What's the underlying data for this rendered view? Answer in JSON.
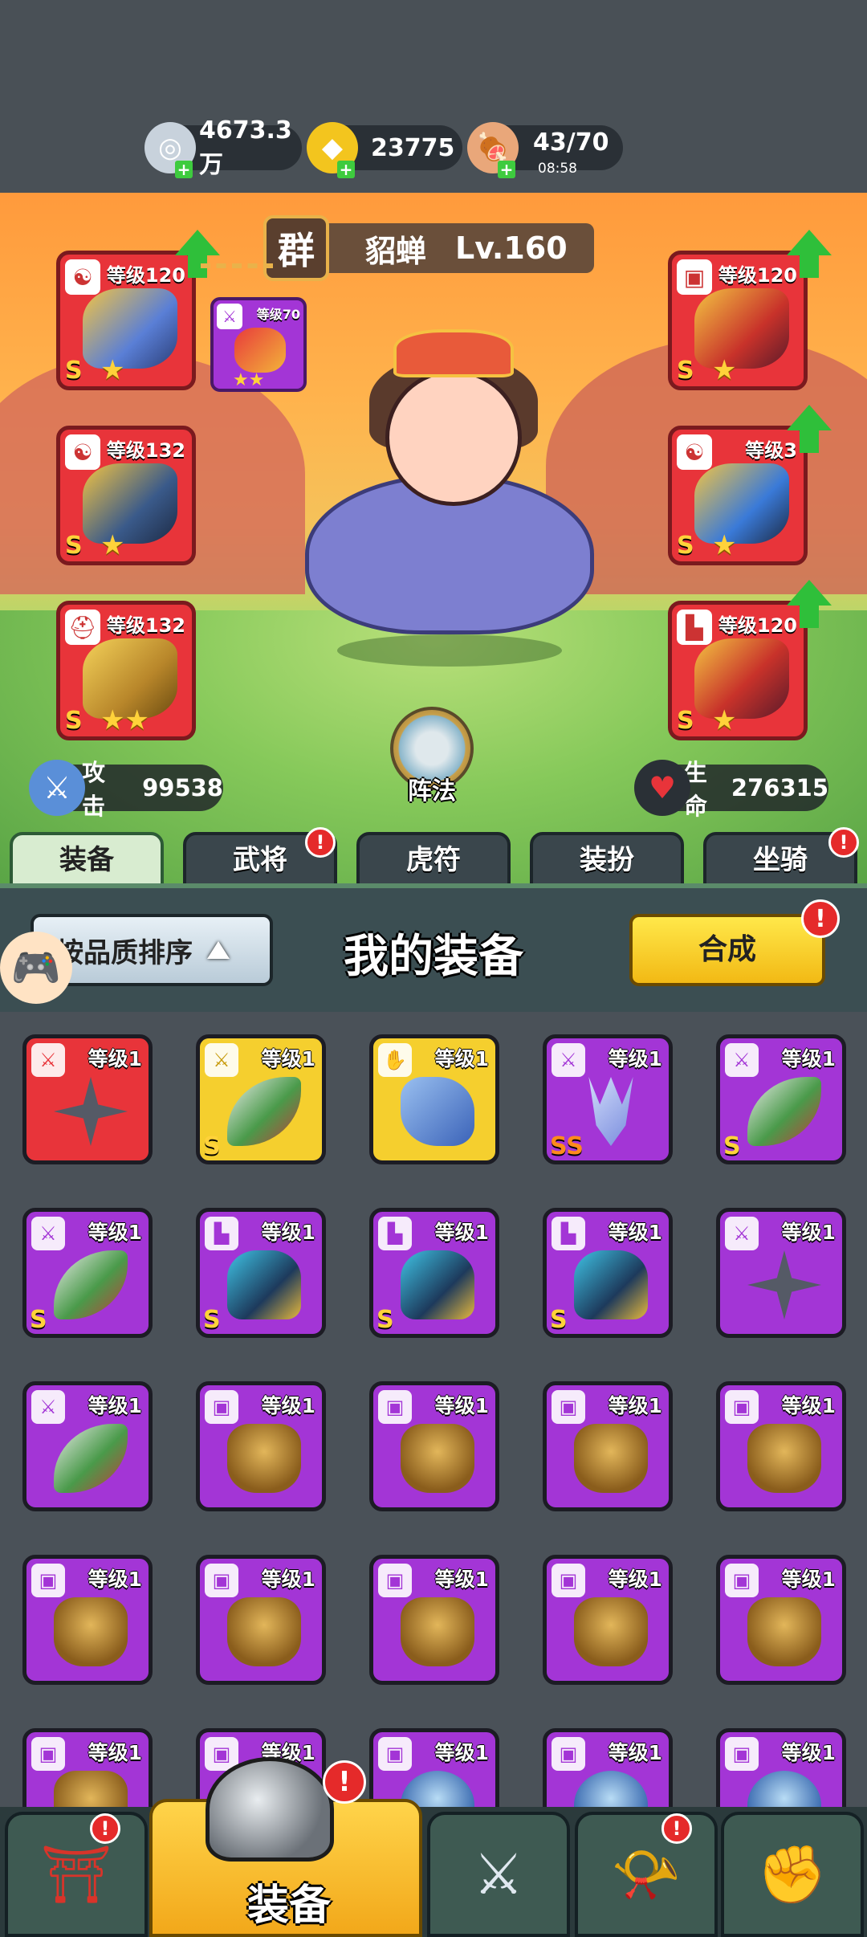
{
  "resources": [
    {
      "name": "silver",
      "icon": "silver-coin-icon",
      "value": "4673.3万"
    },
    {
      "name": "gold",
      "icon": "gold-ingot-icon",
      "value": "23775"
    },
    {
      "name": "stamina",
      "icon": "meat-icon",
      "value": "43/70",
      "timer": "08:58"
    }
  ],
  "hero": {
    "faction": "群",
    "name": "貂蝉",
    "level": "Lv.160"
  },
  "equipped": {
    "left": [
      {
        "slot": "weapon",
        "icon": "yinyang-icon",
        "level": "等级120",
        "rank": "S",
        "stars": "★"
      },
      {
        "slot": "accessory",
        "icon": "yinyang-icon",
        "level": "等级132",
        "rank": "S",
        "stars": "★"
      },
      {
        "slot": "helmet",
        "icon": "helmet-icon",
        "level": "等级132",
        "rank": "S",
        "stars": "★★"
      }
    ],
    "right": [
      {
        "slot": "armor",
        "icon": "armor-icon",
        "level": "等级120",
        "rank": "S",
        "stars": "★"
      },
      {
        "slot": "accessory",
        "icon": "yinyang-icon",
        "level": "等级3",
        "rank": "S",
        "stars": "★"
      },
      {
        "slot": "boots",
        "icon": "boot-icon",
        "level": "等级120",
        "rank": "S",
        "stars": "★"
      }
    ],
    "linked": {
      "level": "等级70",
      "stars": "★★"
    }
  },
  "formation_label": "阵法",
  "stats": {
    "attack_label": "攻击",
    "attack_value": "99538",
    "hp_label": "生命",
    "hp_value": "276315"
  },
  "tabs": [
    {
      "label": "装备",
      "active": true,
      "alert": false
    },
    {
      "label": "武将",
      "active": false,
      "alert": true
    },
    {
      "label": "虎符",
      "active": false,
      "alert": false
    },
    {
      "label": "装扮",
      "active": false,
      "alert": false
    },
    {
      "label": "坐骑",
      "active": false,
      "alert": true
    }
  ],
  "panel": {
    "sort_label": "按品质排序",
    "title": "我的装备",
    "combine_label": "合成",
    "alert": "!"
  },
  "inventory": [
    {
      "color": "red",
      "type": "weapon",
      "art": "shuriken",
      "level": "等级1",
      "rank": ""
    },
    {
      "color": "gold",
      "type": "weapon",
      "art": "blade",
      "level": "等级1",
      "rank": "S"
    },
    {
      "color": "gold",
      "type": "gauntlet",
      "art": "gauntlet",
      "level": "等级1",
      "rank": ""
    },
    {
      "color": "purple",
      "type": "weapon",
      "art": "trident",
      "level": "等级1",
      "rank": "SS"
    },
    {
      "color": "purple",
      "type": "weapon",
      "art": "blade",
      "level": "等级1",
      "rank": "S"
    },
    {
      "color": "purple",
      "type": "weapon",
      "art": "blade",
      "level": "等级1",
      "rank": "S"
    },
    {
      "color": "purple",
      "type": "boots",
      "art": "boots",
      "level": "等级1",
      "rank": "S"
    },
    {
      "color": "purple",
      "type": "boots",
      "art": "boots",
      "level": "等级1",
      "rank": "S"
    },
    {
      "color": "purple",
      "type": "boots",
      "art": "boots",
      "level": "等级1",
      "rank": "S"
    },
    {
      "color": "purple",
      "type": "weapon",
      "art": "shuriken",
      "level": "等级1",
      "rank": ""
    },
    {
      "color": "purple",
      "type": "weapon",
      "art": "blade",
      "level": "等级1",
      "rank": ""
    },
    {
      "color": "purple",
      "type": "armor",
      "art": "armor",
      "level": "等级1",
      "rank": ""
    },
    {
      "color": "purple",
      "type": "armor",
      "art": "armor",
      "level": "等级1",
      "rank": ""
    },
    {
      "color": "purple",
      "type": "armor",
      "art": "armor",
      "level": "等级1",
      "rank": ""
    },
    {
      "color": "purple",
      "type": "armor",
      "art": "armor",
      "level": "等级1",
      "rank": ""
    },
    {
      "color": "purple",
      "type": "armor",
      "art": "armor",
      "level": "等级1",
      "rank": ""
    },
    {
      "color": "purple",
      "type": "armor",
      "art": "armor",
      "level": "等级1",
      "rank": ""
    },
    {
      "color": "purple",
      "type": "armor",
      "art": "armor",
      "level": "等级1",
      "rank": ""
    },
    {
      "color": "purple",
      "type": "armor",
      "art": "armor",
      "level": "等级1",
      "rank": ""
    },
    {
      "color": "purple",
      "type": "armor",
      "art": "armor",
      "level": "等级1",
      "rank": ""
    },
    {
      "color": "purple",
      "type": "armor",
      "art": "armor",
      "level": "等级1",
      "rank": ""
    },
    {
      "color": "purple",
      "type": "armor",
      "art": "helm",
      "level": "等级1",
      "rank": ""
    },
    {
      "color": "purple",
      "type": "armor",
      "art": "helm",
      "level": "等级1",
      "rank": ""
    },
    {
      "color": "purple",
      "type": "armor",
      "art": "helm",
      "level": "等级1",
      "rank": ""
    },
    {
      "color": "purple",
      "type": "armor",
      "art": "helm",
      "level": "等级1",
      "rank": ""
    }
  ],
  "bottom_nav": [
    {
      "name": "gate",
      "icon": "gate-icon",
      "alert": true
    },
    {
      "name": "equipment",
      "icon": "helmet-icon",
      "label": "装备",
      "alert": true,
      "active": true
    },
    {
      "name": "battle",
      "icon": "crossed-swords-icon",
      "alert": false
    },
    {
      "name": "recruit",
      "icon": "horn-icon",
      "alert": true
    },
    {
      "name": "upgrade",
      "icon": "fist-icon",
      "alert": false
    }
  ]
}
